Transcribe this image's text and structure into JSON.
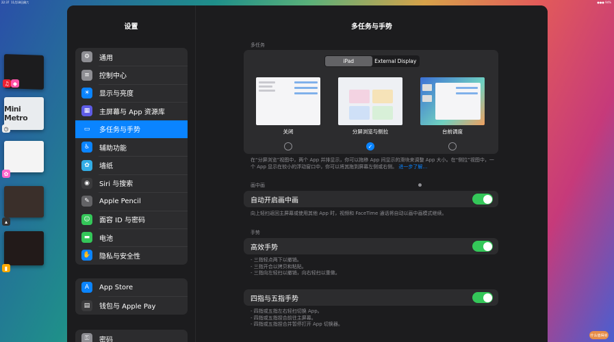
{
  "status": {
    "time": "22:37",
    "date": "11月18日周六",
    "right": "●●● 94%"
  },
  "left_rail": {
    "mini_metro_label": "Mini Metro"
  },
  "sidebar": {
    "title": "设置",
    "group1": [
      {
        "label": "通用",
        "icon": "gear-icon",
        "color": "#8e8e93",
        "glyph": "⚙"
      },
      {
        "label": "控制中心",
        "icon": "toggles-icon",
        "color": "#8e8e93",
        "glyph": "≡"
      },
      {
        "label": "显示与亮度",
        "icon": "sun-icon",
        "color": "#0a84ff",
        "glyph": "☀"
      },
      {
        "label": "主屏幕与 App 资源库",
        "icon": "grid-icon",
        "color": "#5e5ce6",
        "glyph": "▦"
      },
      {
        "label": "多任务与手势",
        "icon": "multitask-icon",
        "color": "#0a84ff",
        "glyph": "▭",
        "active": true
      },
      {
        "label": "辅助功能",
        "icon": "accessibility-icon",
        "color": "#0a84ff",
        "glyph": "♿"
      },
      {
        "label": "墙纸",
        "icon": "flower-icon",
        "color": "#32ade6",
        "glyph": "✿"
      },
      {
        "label": "Siri 与搜索",
        "icon": "siri-icon",
        "color": "#3a3a3c",
        "glyph": "◉"
      },
      {
        "label": "Apple Pencil",
        "icon": "pencil-icon",
        "color": "#636366",
        "glyph": "✎"
      },
      {
        "label": "面容 ID 与密码",
        "icon": "faceid-icon",
        "color": "#34c759",
        "glyph": "☺"
      },
      {
        "label": "电池",
        "icon": "battery-icon",
        "color": "#34c759",
        "glyph": "▬"
      },
      {
        "label": "隐私与安全性",
        "icon": "hand-icon",
        "color": "#0a84ff",
        "glyph": "✋"
      }
    ],
    "group2": [
      {
        "label": "App Store",
        "icon": "appstore-icon",
        "color": "#0a84ff",
        "glyph": "A"
      },
      {
        "label": "钱包与 Apple Pay",
        "icon": "wallet-icon",
        "color": "#3a3a3c",
        "glyph": "▤"
      }
    ],
    "group3": [
      {
        "label": "密码",
        "icon": "key-icon",
        "color": "#8e8e93",
        "glyph": "⚿"
      }
    ]
  },
  "detail": {
    "title": "多任务与手势",
    "multitask_section": "多任务",
    "segments": [
      "iPad",
      "External Display"
    ],
    "options": [
      {
        "label": "关闭",
        "selected": false
      },
      {
        "label": "分屏浏览与侧拉",
        "selected": true
      },
      {
        "label": "台前调度",
        "selected": false
      }
    ],
    "multitask_note": "在“分屏浏览”视图中，两个 App 并排显示，你可以拖移 App 间显示的滑块来调整 App 大小。在“侧拉”视图中，一个 App 显示在较小的浮动窗口中，你可以将其拖到屏幕左侧或右侧。",
    "multitask_link": "进一步了解…",
    "pip_section": "画中画",
    "pip_row": "自动开启画中画",
    "pip_note": "向上轻扫返回主屏幕或使用其他 App 时，视频和 FaceTime 通话将自动以画中画模式继续。",
    "gestures_section": "手势",
    "gesture_row": "高效手势",
    "gesture_notes": [
      "- 三指轻点两下以撤销。",
      "- 三指开合以拷贝和粘贴。",
      "- 三指向左轻扫以撤销，向右轻扫以重做。"
    ],
    "four_five_row": "四指与五指手势",
    "four_five_notes": [
      "- 四指或五指左右轻扫切换 App。",
      "- 四指或五指捏合前往主屏幕。",
      "- 四指或五指捏合并暂停打开 App 切换器。"
    ]
  },
  "watermark": "什么值得买"
}
